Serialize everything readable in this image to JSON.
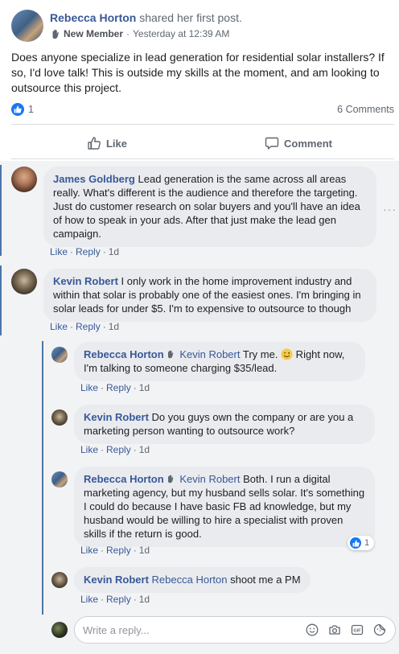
{
  "post": {
    "author": "Rebecca Horton",
    "action": "shared her first post.",
    "badge": "New Member",
    "time": "Yesterday at 12:39 AM",
    "body": "Does anyone specialize in lead generation for residential solar installers? If so, I'd love talk! This is outside my skills at the moment, and am looking to outsource this project.",
    "reaction_count": "1",
    "comments_count": "6 Comments",
    "like_label": "Like",
    "comment_label": "Comment"
  },
  "comments": [
    {
      "author": "James Goldberg",
      "text": "Lead generation is the same across all areas really. What's different is the audience and therefore the targeting. Just do customer research on solar buyers and you'll have an idea of how to speak in your ads. After that just make the lead gen campaign.",
      "like": "Like",
      "reply": "Reply",
      "time": "1d"
    },
    {
      "author": "Kevin Robert",
      "text": "I only work in the home improvement industry and within that solar is probably one of the easiest ones. I'm bringing in solar leads for under $5. I'm to expensive to outsource to though",
      "like": "Like",
      "reply": "Reply",
      "time": "1d"
    }
  ],
  "replies": [
    {
      "author": "Rebecca Horton",
      "mention": "Kevin Robert",
      "text_line1": "Try me. ",
      "text_line1_end": " Right now,",
      "text_line2": "I'm talking to someone charging $35/lead.",
      "like": "Like",
      "reply": "Reply",
      "time": "1d"
    },
    {
      "author": "Kevin Robert",
      "text": "Do you guys own the company or are you a marketing person wanting to outsource work?",
      "like": "Like",
      "reply": "Reply",
      "time": "1d"
    },
    {
      "author": "Rebecca Horton",
      "mention": "Kevin Robert",
      "text": "Both. I run a digital marketing agency, but my husband sells solar. It's something I could do because I have basic FB ad knowledge, but my husband would be willing to hire a specialist with proven skills if the return is good.",
      "like": "Like",
      "reply": "Reply",
      "time": "1d",
      "reaction_count": "1"
    },
    {
      "author": "Kevin Robert",
      "mention": "Rebecca Horton",
      "text": "shoot me a PM",
      "like": "Like",
      "reply": "Reply",
      "time": "1d"
    }
  ],
  "reply_box": {
    "placeholder": "Write a reply..."
  },
  "icons": [
    "wave-icon",
    "like-icon",
    "thumbs-up-icon",
    "comment-icon",
    "more-dots-icon",
    "emoji-icon",
    "camera-icon",
    "gif-icon",
    "sticker-icon",
    "wink-emoji-icon"
  ],
  "colors": {
    "link": "#385898",
    "like_blue": "#1877f2",
    "bubble": "#e9ebee",
    "thread_line": "#4a76a8"
  }
}
